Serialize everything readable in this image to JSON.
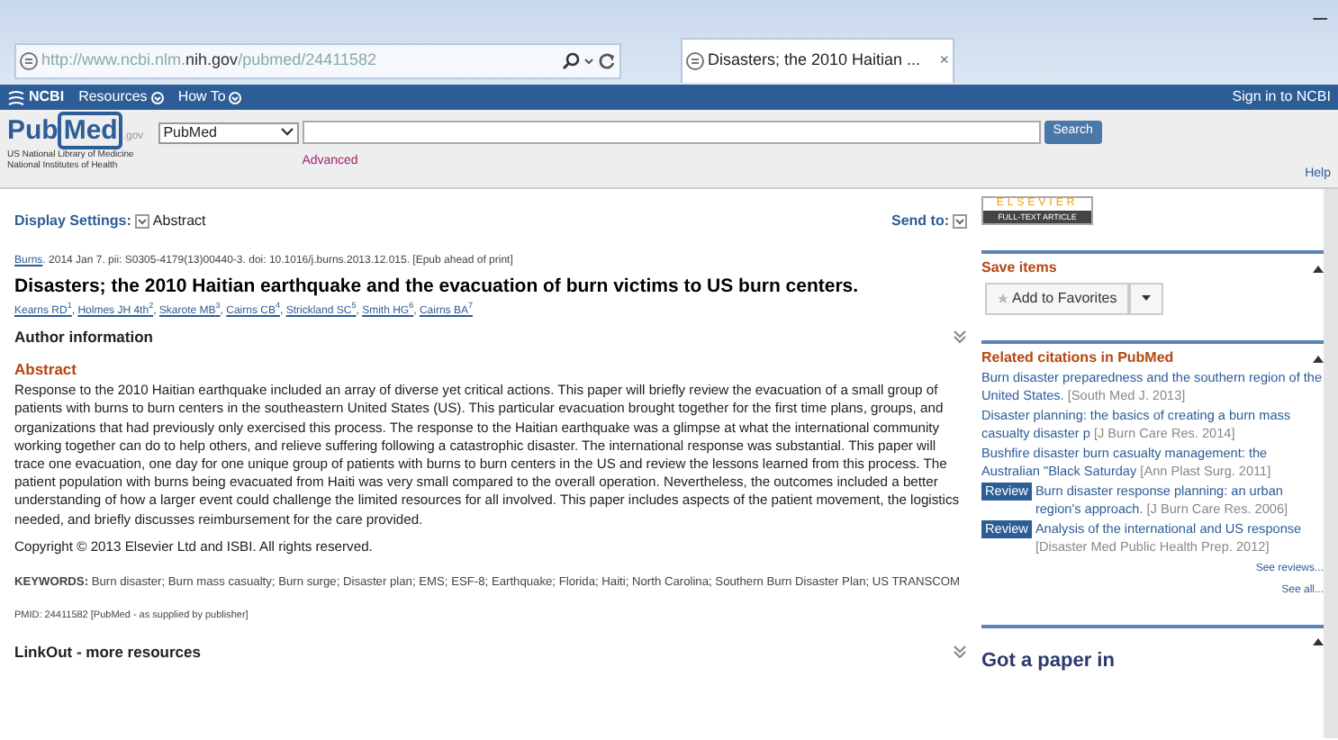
{
  "browser": {
    "url_prefix": "http://www.ncbi.nlm.",
    "url_domain": "nih.gov",
    "url_path": "/pubmed/24411582",
    "tab_title": "Disasters; the 2010 Haitian ...",
    "tab_close": "×",
    "minimize": "–"
  },
  "ncbi_bar": {
    "logo": "NCBI",
    "menus": [
      "Resources",
      "How To"
    ],
    "sign_in": "Sign in to NCBI"
  },
  "search_header": {
    "logo_parts": [
      "Pub",
      "Med"
    ],
    "logo_suffix": ".gov",
    "tagline": [
      "US National Library of Medicine",
      "National Institutes of Health"
    ],
    "database": "PubMed",
    "button": "Search",
    "advanced": "Advanced",
    "help": "Help"
  },
  "display": {
    "label": "Display Settings:",
    "format": "Abstract",
    "send_to": "Send to:"
  },
  "article": {
    "journal": "Burns",
    "citation": ". 2014 Jan 7. pii: S0305-4179(13)00440-3. doi: 10.1016/j.burns.2013.12.015. [Epub ahead of print]",
    "title": "Disasters; the 2010 Haitian earthquake and the evacuation of burn victims to US burn centers.",
    "authors": [
      {
        "name": "Kearns RD",
        "sup": "1"
      },
      {
        "name": "Holmes JH 4th",
        "sup": "2"
      },
      {
        "name": "Skarote MB",
        "sup": "3"
      },
      {
        "name": "Cairns CB",
        "sup": "4"
      },
      {
        "name": "Strickland SC",
        "sup": "5"
      },
      {
        "name": "Smith HG",
        "sup": "6"
      },
      {
        "name": "Cairns BA",
        "sup": "7"
      }
    ],
    "author_separator": ",",
    "author_info": "Author information",
    "abstract_heading": "Abstract",
    "abstract": "Response to the 2010 Haitian earthquake included an array of diverse yet critical actions. This paper will briefly review the evacuation of a small group of patients with burns to burn centers in the southeastern United States (US). This particular evacuation brought together for the first time plans, groups, and organizations that had previously only exercised this process. The response to the Haitian earthquake was a glimpse at what the international community working together can do to help others, and relieve suffering following a catastrophic disaster. The international response was substantial. This paper will trace one evacuation, one day for one unique group of patients with burns to burn centers in the US and review the lessons learned from this process. The patient population with burns being evacuated from Haiti was very small compared to the overall operation. Nevertheless, the outcomes included a better understanding of how a larger event could challenge the limited resources for all involved. This paper includes aspects of the patient movement, the logistics needed, and briefly discusses reimbursement for the care provided.",
    "copyright": "Copyright © 2013 Elsevier Ltd and ISBI. All rights reserved.",
    "keywords_label": "KEYWORDS:",
    "keywords": "Burn disaster; Burn mass casualty; Burn surge; Disaster plan; EMS; ESF-8; Earthquake; Florida; Haiti; North Carolina; Southern Burn Disaster Plan; US TRANSCOM",
    "pmid": "PMID: 24411582 [PubMed - as supplied by publisher]",
    "linkout": "LinkOut - more resources"
  },
  "sidebar": {
    "publisher_logo": [
      "ELSEVIER",
      "FULL-TEXT ARTICLE"
    ],
    "save_items": {
      "heading": "Save items",
      "button": "Add to Favorites"
    },
    "related": {
      "heading": "Related citations in PubMed",
      "items": [
        {
          "title": "Burn disaster preparedness and the southern region of the United States.",
          "source": "[South Med J. 2013]"
        },
        {
          "title": "Disaster planning: the basics of creating a burn mass casualty disaster p",
          "source": "[J Burn Care Res. 2014]"
        },
        {
          "title": "Bushfire disaster burn casualty management: the Australian \"Black Saturday",
          "source": "[Ann Plast Surg. 2011]"
        },
        {
          "badge": "Review",
          "title": "Burn disaster response planning: an urban region's approach.",
          "source": "[J Burn Care Res. 2006]"
        },
        {
          "badge": "Review",
          "title": "Analysis of the international and US response",
          "source": "[Disaster Med Public Health Prep. 2012]"
        }
      ],
      "see_reviews": "See reviews...",
      "see_all": "See all..."
    },
    "next_heading": "Got a paper in"
  }
}
